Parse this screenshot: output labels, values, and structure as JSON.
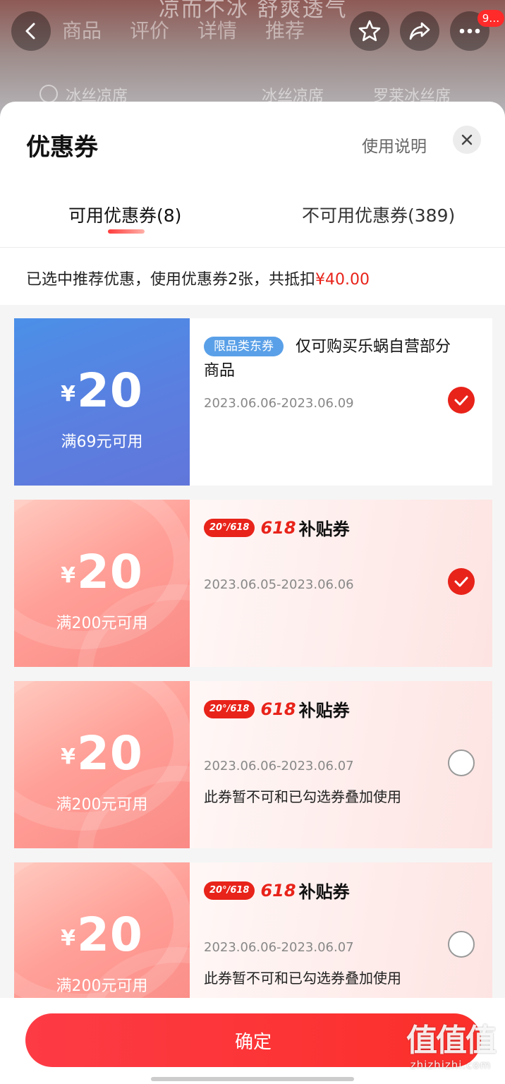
{
  "product": {
    "bg_title": "凉而不冰 舒爽透气",
    "nav_tabs": [
      "商品",
      "评价",
      "详情",
      "推荐"
    ],
    "more_badge": "9…",
    "options": [
      "冰丝凉席",
      "冰丝凉席",
      "罗莱冰丝席"
    ]
  },
  "sheet": {
    "title": "优惠券",
    "help_link": "使用说明",
    "tabs": {
      "available": "可用优惠券(8)",
      "unavailable": "不可用优惠券(389)"
    },
    "summary_text": "已选中推荐优惠，使用优惠券2张，共抵扣",
    "summary_amount": "¥40.00"
  },
  "coupons": [
    {
      "currency": "¥",
      "amount": "20",
      "threshold": "满69元可用",
      "tag": "限品类东券",
      "title": "仅可购买乐蜗自营部分商品",
      "date": "2023.06.06-2023.06.09",
      "note": "",
      "selected": true,
      "style": "blue"
    },
    {
      "currency": "¥",
      "amount": "20",
      "threshold": "满200元可用",
      "promo_badge": "20°/618",
      "promo_618": "618",
      "promo_text": "补贴券",
      "date": "2023.06.05-2023.06.06",
      "note": "",
      "selected": true,
      "style": "salmon"
    },
    {
      "currency": "¥",
      "amount": "20",
      "threshold": "满200元可用",
      "promo_badge": "20°/618",
      "promo_618": "618",
      "promo_text": "补贴券",
      "date": "2023.06.06-2023.06.07",
      "note": "此券暂不可和已勾选券叠加使用",
      "selected": false,
      "style": "salmon"
    },
    {
      "currency": "¥",
      "amount": "20",
      "threshold": "满200元可用",
      "promo_badge": "20°/618",
      "promo_618": "618",
      "promo_text": "补贴券",
      "date": "2023.06.06-2023.06.07",
      "note": "此券暂不可和已勾选券叠加使用",
      "selected": false,
      "style": "salmon"
    }
  ],
  "footer": {
    "confirm_label": "确定"
  },
  "watermark": {
    "logo": "值值值",
    "url": "zhizhizhi.com"
  },
  "colors": {
    "accent": "#e8231a",
    "confirm_button": "#fb2f2a",
    "blue_coupon": "#5a7fe0",
    "salmon_coupon": "#fa8a85",
    "tag_blue": "#5aa0e8"
  },
  "icons": {
    "back": "chevron-left-icon",
    "favorite": "star-icon",
    "share": "share-icon",
    "more": "more-dots-icon",
    "close": "close-icon",
    "check": "checkmark-icon"
  }
}
